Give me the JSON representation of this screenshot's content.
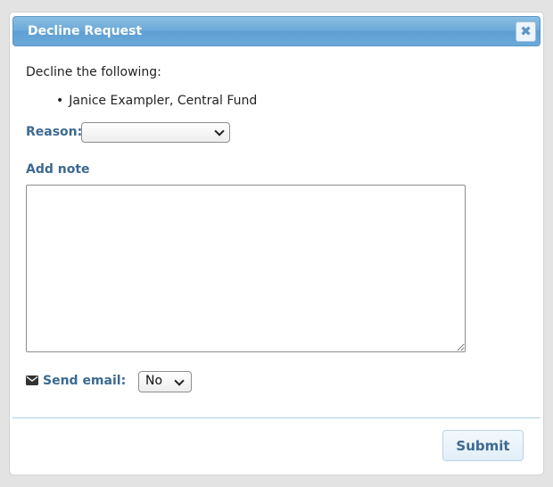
{
  "dialog": {
    "title": "Decline Request",
    "close_symbol": "✖",
    "intro": "Decline the following:",
    "items": [
      "Janice Exampler, Central Fund"
    ],
    "reason": {
      "label": "Reason:",
      "selected": ""
    },
    "note": {
      "label": "Add note",
      "value": ""
    },
    "email": {
      "label": "Send email:",
      "selected": "No",
      "icon": "envelope-icon"
    },
    "submit_label": "Submit"
  },
  "colors": {
    "title_bar": "#6aa9d8",
    "label": "#3c6a91",
    "button_bg": "#e2eef8"
  }
}
